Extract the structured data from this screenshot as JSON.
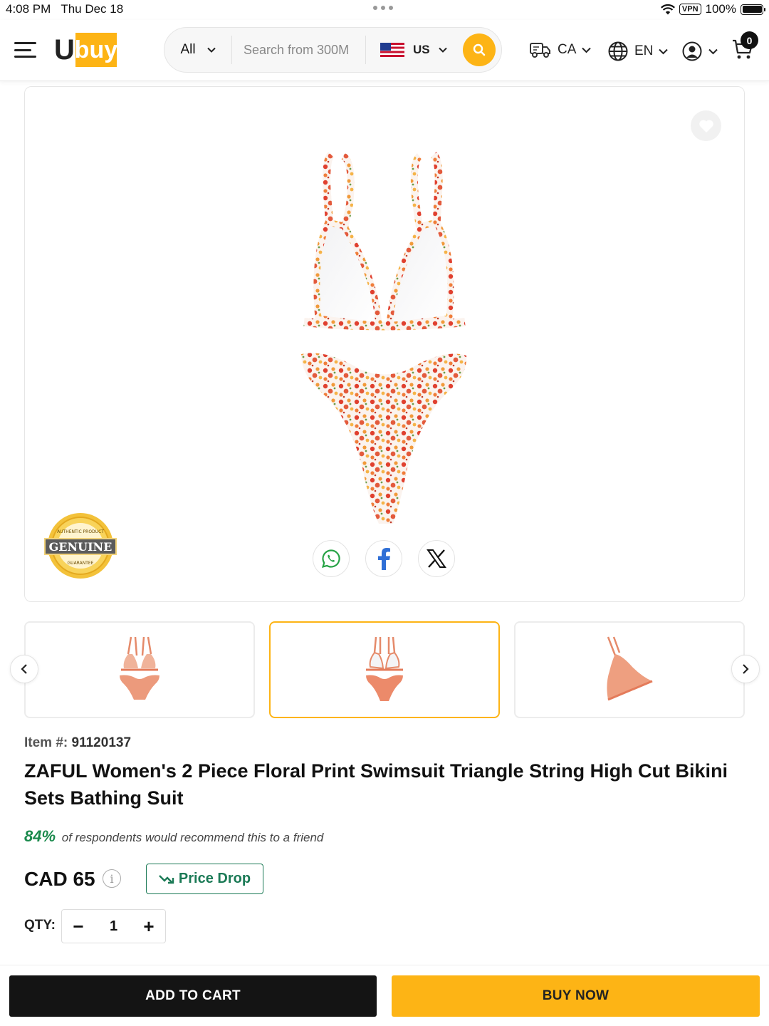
{
  "status_bar": {
    "time": "4:08 PM",
    "date": "Thu Dec 18",
    "vpn": "VPN",
    "battery": "100%"
  },
  "header": {
    "logo_letter": "U",
    "logo_text": "buy",
    "search": {
      "category": "All",
      "placeholder": "Search from 300M",
      "store": "US"
    },
    "ship_to": "CA",
    "language": "EN",
    "cart_count": "0"
  },
  "product": {
    "genuine_badge": {
      "top": "AUTHENTIC PRODUCT",
      "main": "GENUINE",
      "bottom": "GUARANTEE"
    },
    "item_label": "Item #:",
    "item_number": "91120137",
    "title": "ZAFUL Women's 2 Piece Floral Print Swimsuit Triangle String High Cut Bikini Sets Bathing Suit",
    "recommend_pct": "84%",
    "recommend_text": "of respondents would recommend this to a friend",
    "price": "CAD 65",
    "info_icon": "i",
    "price_drop_label": "Price Drop",
    "qty_label": "QTY:",
    "qty_value": "1",
    "qty_minus": "−",
    "qty_plus": "+"
  },
  "thumbnails": {
    "selected_index": 1,
    "count": 3
  },
  "actions": {
    "add_to_cart": "ADD TO CART",
    "buy_now": "BUY NOW"
  },
  "colors": {
    "brand": "#fdb415",
    "recommend_green": "#1b8a4d",
    "price_drop_green": "#1b7a56",
    "dark_button": "#141414"
  },
  "icons": [
    "hamburger-icon",
    "search-icon",
    "truck-icon",
    "globe-icon",
    "user-icon",
    "cart-icon",
    "heart-icon",
    "whatsapp-icon",
    "facebook-icon",
    "x-icon",
    "chevron-left-icon",
    "chevron-right-icon",
    "trend-down-icon"
  ]
}
